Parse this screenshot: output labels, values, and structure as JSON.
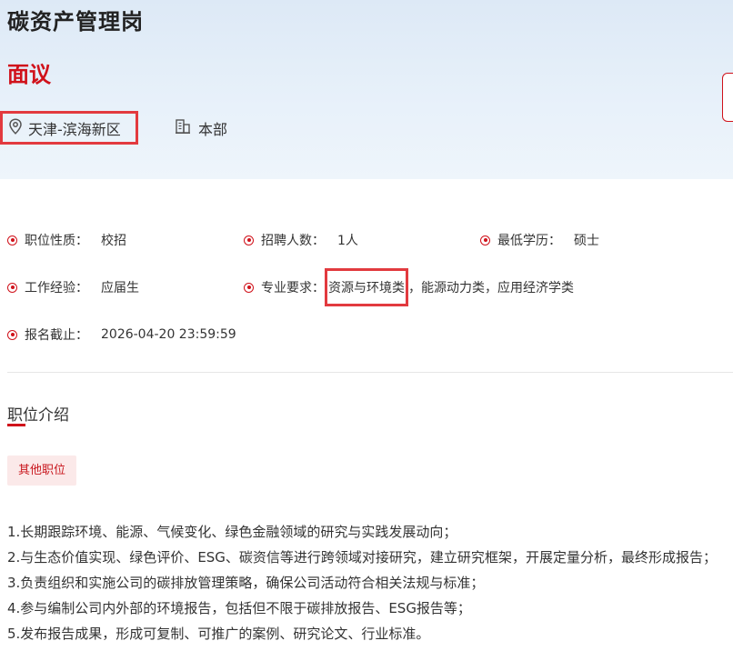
{
  "job": {
    "title": "碳资产管理岗",
    "salary": "面议",
    "location": "天津-滨海新区",
    "department": "本部"
  },
  "attributes": [
    {
      "label": "职位性质：",
      "value": "校招"
    },
    {
      "label": "招聘人数：",
      "value": "1人"
    },
    {
      "label": "最低学历：",
      "value": "硕士"
    },
    {
      "label": "工作经验：",
      "value": "应届生"
    },
    {
      "label": "专业要求：",
      "value_highlight": "资源与环境类",
      "value_rest": "，能源动力类，应用经济学类"
    },
    {
      "label": "报名截止：",
      "value": "2026-04-20 23:59:59"
    }
  ],
  "section": {
    "title": "职位介绍",
    "tag": "其他职位"
  },
  "description": [
    "1.长期跟踪环境、能源、气候变化、绿色金融领域的研究与实践发展动向；",
    "2.与生态价值实现、绿色评价、ESG、碳资信等进行跨领域对接研究，建立研究框架，开展定量分析，最终形成报告；",
    "3.负责组织和实施公司的碳排放管理策略，确保公司活动符合相关法规与标准；",
    "4.参与编制公司内外部的环境报告，包括但不限于碳排放报告、ESG报告等；",
    "5.发布报告成果，形成可复制、可推广的案例、研究论文、行业标准。"
  ],
  "colors": {
    "accent": "#d0121b",
    "highlight_border": "#e23a3f",
    "header_bg": "#e3eef8",
    "tag_bg": "#fbe9e9"
  },
  "icons": {
    "location": "map-pin-icon",
    "department": "building-icon",
    "attribute_bullet": "target-dot-icon"
  }
}
